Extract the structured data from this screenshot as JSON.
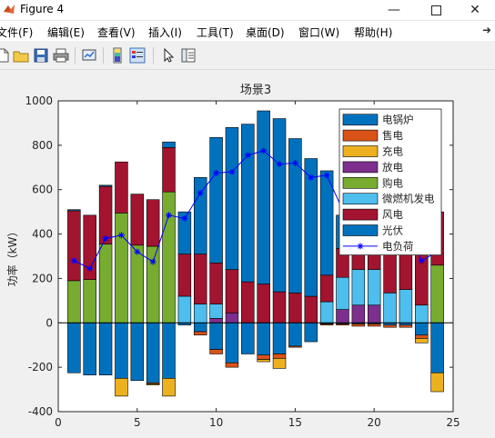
{
  "window": {
    "title": "Figure 4"
  },
  "menu": [
    {
      "label": "文件(F)"
    },
    {
      "label": "编辑(E)"
    },
    {
      "label": "查看(V)"
    },
    {
      "label": "插入(I)"
    },
    {
      "label": "工具(T)"
    },
    {
      "label": "桌面(D)"
    },
    {
      "label": "窗口(W)"
    },
    {
      "label": "帮助(H)"
    }
  ],
  "toolbar": [
    {
      "icon": "new-file-icon"
    },
    {
      "icon": "open-folder-icon"
    },
    {
      "icon": "save-icon"
    },
    {
      "icon": "print-icon"
    },
    {
      "icon": "link-plot-icon"
    },
    {
      "icon": "colorbar-icon"
    },
    {
      "icon": "legend-icon"
    },
    {
      "icon": "pointer-icon"
    },
    {
      "icon": "property-inspector-icon"
    }
  ],
  "chart_data": {
    "type": "bar",
    "title": "场景3",
    "ylabel": "功率（kW）",
    "xlabel": "",
    "xlim": [
      0,
      25
    ],
    "ylim": [
      -400,
      1000
    ],
    "xticks": [
      0,
      5,
      10,
      15,
      20,
      25
    ],
    "yticks": [
      -400,
      -200,
      0,
      200,
      400,
      600,
      800,
      1000
    ],
    "legend_position": "top-right",
    "x": [
      1,
      2,
      3,
      4,
      5,
      6,
      7,
      8,
      9,
      10,
      11,
      12,
      13,
      14,
      15,
      16,
      17,
      18,
      19,
      20,
      21,
      22,
      23,
      24
    ],
    "series": [
      {
        "name": "电锅炉",
        "color": "#0072bd",
        "values": [
          -225,
          -235,
          -235,
          -250,
          -260,
          -270,
          -250,
          -10,
          -40,
          -120,
          -180,
          -140,
          -145,
          -140,
          -105,
          -85,
          -5,
          -5,
          -5,
          -5,
          -10,
          -10,
          -55,
          -225
        ]
      },
      {
        "name": "售电",
        "color": "#d95319",
        "values": [
          0,
          0,
          0,
          0,
          0,
          -5,
          0,
          0,
          -15,
          -20,
          -20,
          0,
          -20,
          -20,
          -5,
          0,
          -5,
          -5,
          -10,
          -10,
          -10,
          -10,
          -15,
          0
        ]
      },
      {
        "name": "充电",
        "color": "#edb120",
        "values": [
          0,
          0,
          0,
          -80,
          0,
          -5,
          -80,
          0,
          0,
          0,
          0,
          0,
          -10,
          -45,
          0,
          0,
          0,
          0,
          0,
          0,
          0,
          0,
          -20,
          -85
        ]
      },
      {
        "name": "放电",
        "color": "#7e2f8e",
        "values": [
          0,
          0,
          0,
          0,
          0,
          0,
          0,
          0,
          0,
          20,
          45,
          0,
          0,
          0,
          0,
          0,
          0,
          60,
          80,
          80,
          0,
          0,
          0,
          0
        ]
      },
      {
        "name": "购电",
        "color": "#77ac30",
        "values": [
          190,
          195,
          355,
          495,
          350,
          345,
          590,
          0,
          0,
          0,
          0,
          0,
          0,
          0,
          0,
          0,
          0,
          0,
          0,
          0,
          0,
          0,
          0,
          260
        ]
      },
      {
        "name": "微燃机发电",
        "color": "#4dbeee",
        "values": [
          0,
          0,
          0,
          0,
          0,
          0,
          0,
          120,
          85,
          65,
          0,
          0,
          0,
          0,
          0,
          0,
          95,
          145,
          160,
          160,
          135,
          150,
          80,
          0
        ]
      },
      {
        "name": "风电",
        "color": "#a2142f",
        "values": [
          315,
          290,
          260,
          230,
          230,
          210,
          200,
          190,
          225,
          185,
          195,
          185,
          175,
          140,
          135,
          120,
          120,
          130,
          220,
          235,
          220,
          210,
          280,
          240
        ]
      },
      {
        "name": "光伏",
        "color": "#0072bd",
        "values": [
          5,
          0,
          5,
          0,
          0,
          0,
          25,
          190,
          345,
          565,
          640,
          710,
          780,
          780,
          695,
          620,
          470,
          150,
          10,
          0,
          0,
          0,
          0,
          0
        ]
      }
    ],
    "line": {
      "name": "电负荷",
      "color": "#0000ff",
      "marker": "*",
      "values": [
        280,
        245,
        380,
        395,
        320,
        275,
        485,
        470,
        585,
        675,
        680,
        755,
        775,
        715,
        720,
        655,
        665,
        510,
        470,
        445,
        445,
        435,
        280,
        320
      ]
    }
  }
}
